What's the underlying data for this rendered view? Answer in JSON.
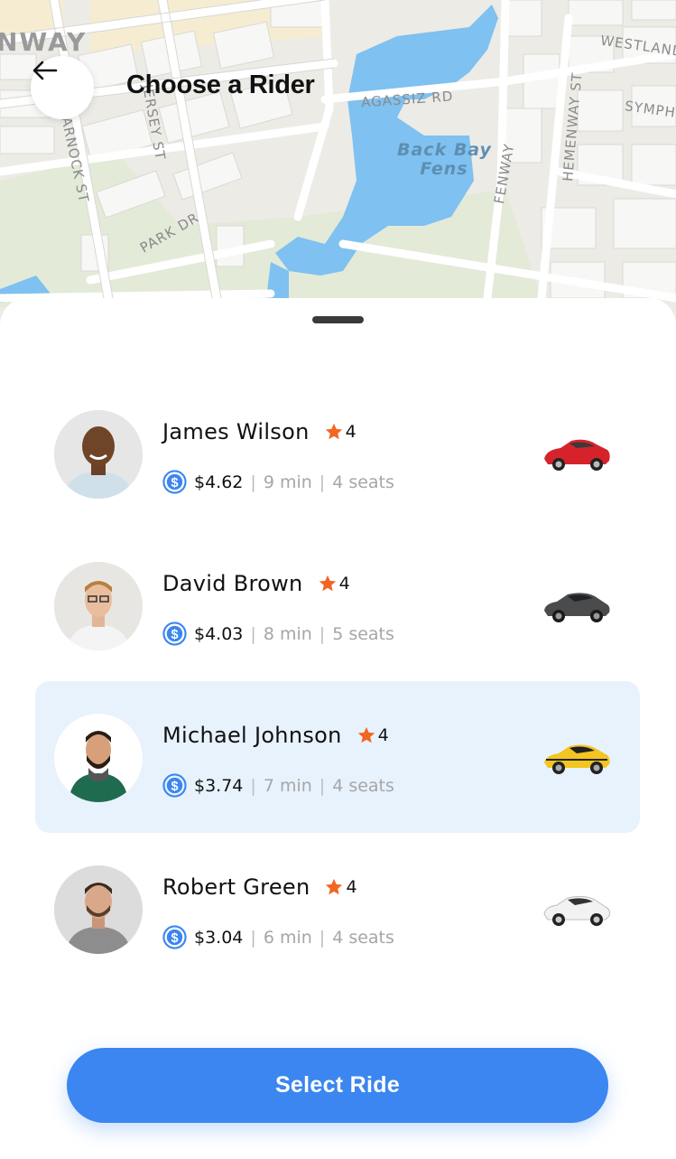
{
  "header": {
    "title": "Choose a Rider",
    "back_icon": "arrow-left-icon"
  },
  "map": {
    "labels": {
      "neighborhood": "NWAY",
      "street_jersey": "JERSEY ST",
      "street_agassiz": "AGASSIZ RD",
      "street_westland": "WESTLAND",
      "street_symph": "SYMPH",
      "street_hemenway": "HEMENWAY ST",
      "street_fenway": "FENWAY",
      "street_arnock": "ARNOCK ST",
      "street_park": "PARK DR",
      "water_line1": "Back Bay",
      "water_line2": "Fens"
    },
    "colors": {
      "land": "#ecebe6",
      "water": "#7fc1f0",
      "park": "#dfe8d5",
      "block": "#f6f6f4",
      "road": "#ffffff"
    }
  },
  "riders": [
    {
      "name": "James Wilson",
      "rating": "4",
      "price": "$4.62",
      "eta": "9 min",
      "seats": "4 seats",
      "car_color": "#d6232b",
      "car_icon": "sports-car-icon",
      "selected": false
    },
    {
      "name": "David Brown",
      "rating": "4",
      "price": "$4.03",
      "eta": "8 min",
      "seats": "5 seats",
      "car_color": "#4a4b4d",
      "car_icon": "sedan-icon",
      "selected": false
    },
    {
      "name": "Michael Johnson",
      "rating": "4",
      "price": "$3.74",
      "eta": "7 min",
      "seats": "4 seats",
      "car_color": "#f3c520",
      "car_icon": "muscle-car-icon",
      "selected": true
    },
    {
      "name": "Robert Green",
      "rating": "4",
      "price": "$3.04",
      "eta": "6 min",
      "seats": "4 seats",
      "car_color": "#f2f2f2",
      "car_icon": "sedan-icon",
      "selected": false
    }
  ],
  "separator": "|",
  "select_button": {
    "label": "Select Ride"
  },
  "colors": {
    "accent": "#3b86f0",
    "star": "#f26522",
    "selected_row": "#e8f2fd"
  }
}
